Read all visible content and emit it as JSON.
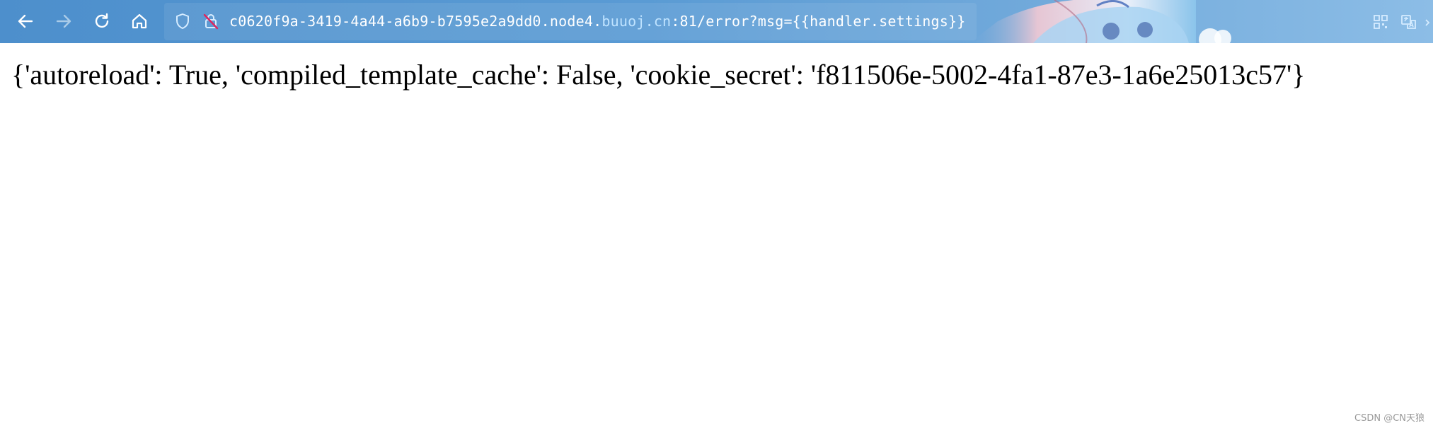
{
  "browser": {
    "url": {
      "segment_main": "c0620f9a-3419-4a44-a6b9-b7595e2a9dd0.node4.",
      "segment_domain": "buuoj.cn",
      "segment_path": ":81/error?msg={{handler.settings}}"
    },
    "icons": {
      "back": "arrow-left-icon",
      "forward": "arrow-right-icon",
      "reload": "reload-icon",
      "home": "home-icon",
      "shield": "shield-icon",
      "insecure": "insecure-lock-icon",
      "qr": "qr-code-icon",
      "translate": "translate-icon"
    },
    "colors": {
      "toolbar": "#5a9bd4",
      "url_text": "#ffffff",
      "url_domain": "#bfe3ff"
    }
  },
  "page": {
    "body_text": "{'autoreload': True, 'compiled_template_cache': False, 'cookie_secret': 'f811506e-5002-4fa1-87e3-1a6e25013c57'}"
  },
  "watermark": "CSDN @CN天狼"
}
